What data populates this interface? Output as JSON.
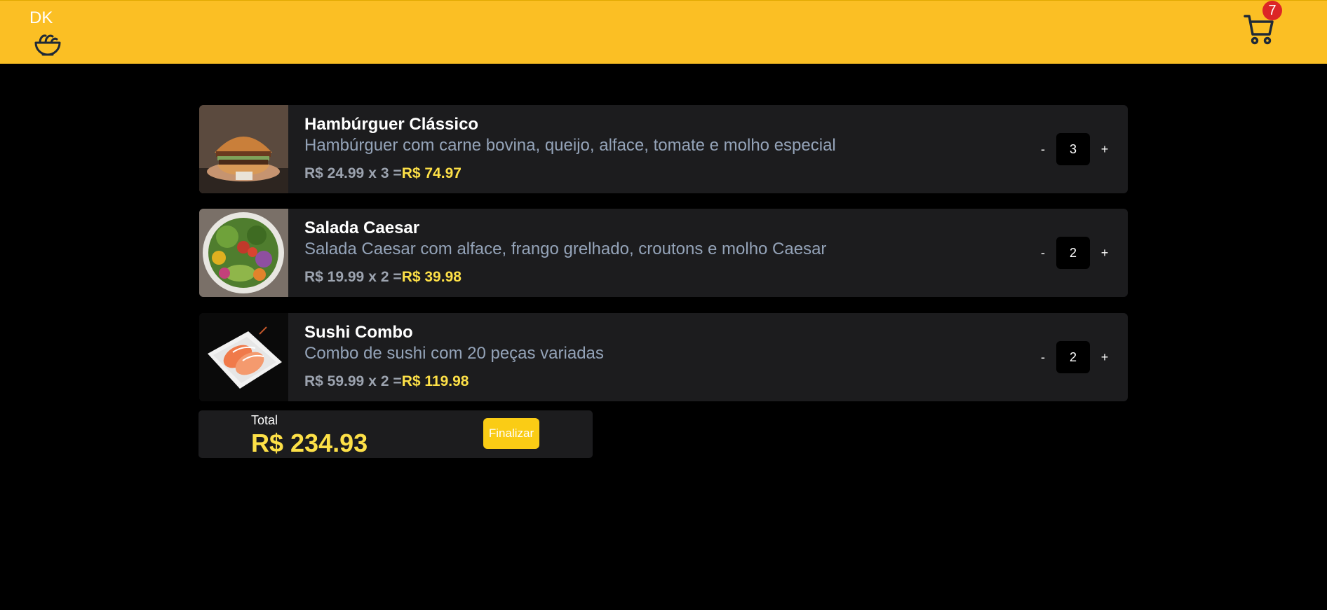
{
  "header": {
    "logo_text": "DK",
    "logo_icon": "food-bowl-icon",
    "cart_icon": "shopping-cart-icon",
    "cart_count": "7",
    "background_color": "#fbbf24",
    "badge_color": "#dc2626"
  },
  "items": [
    {
      "name": "Hambúrguer Clássico",
      "description": "Hambúrguer com carne bovina, queijo, alface, tomate e molho especial",
      "price": "R$ 24.99",
      "times": "x",
      "qty_text": "3 =",
      "subtotal": "R$ 74.97",
      "quantity": "3",
      "minus": "-",
      "plus": "+"
    },
    {
      "name": "Salada Caesar",
      "description": "Salada Caesar com alface, frango grelhado, croutons e molho Caesar",
      "price": "R$ 19.99",
      "times": "x",
      "qty_text": "2 =",
      "subtotal": "R$ 39.98",
      "quantity": "2",
      "minus": "-",
      "plus": "+"
    },
    {
      "name": "Sushi Combo",
      "description": "Combo de sushi com 20 peças variadas",
      "price": "R$ 59.99",
      "times": "x",
      "qty_text": "2 =",
      "subtotal": "R$ 119.98",
      "quantity": "2",
      "minus": "-",
      "plus": "+"
    }
  ],
  "summary": {
    "total_label": "Total",
    "total_value": "R$ 234.93",
    "finalize_label": "Finalizar",
    "accent_color": "#fde047",
    "button_color": "#facc15"
  }
}
